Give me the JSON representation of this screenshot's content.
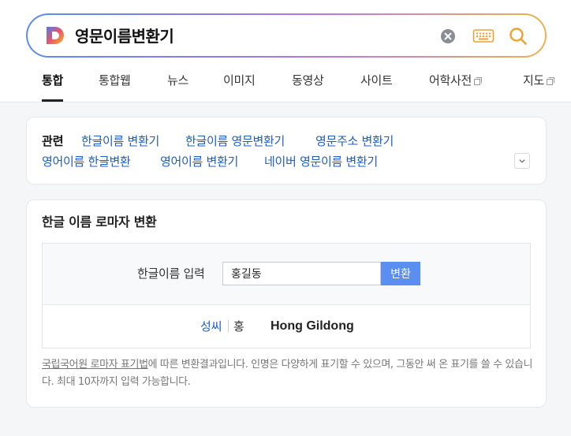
{
  "search": {
    "query": "영문이름변환기"
  },
  "tabs": [
    {
      "label": "통합"
    },
    {
      "label": "통합웹"
    },
    {
      "label": "뉴스"
    },
    {
      "label": "이미지"
    },
    {
      "label": "동영상"
    },
    {
      "label": "사이트"
    },
    {
      "label": "어학사전"
    },
    {
      "label": "지도"
    }
  ],
  "related": {
    "label": "관련",
    "links": [
      "한글이름 변환기",
      "한글이름 영문변환기",
      "영문주소 변환기",
      "영어이름 한글변환",
      "영어이름 변환기",
      "네이버 영문이름 변환기"
    ]
  },
  "converter": {
    "title": "한글 이름 로마자 변환",
    "input_label": "한글이름 입력",
    "input_value": "홍길동",
    "button_label": "변환",
    "sort_label": "성씨",
    "surname": "홍",
    "result": "Hong Gildong",
    "note_link": "국립국어원 로마자 표기법",
    "note_text": "에 따른 변환결과입니다. 인명은 다양하게 표기할 수 있으며, 그동안 써 온 표기를 쓸 수 있습니다. 최대 10자까지 입력 가능합니다."
  },
  "colors": {
    "link": "#1b5ec8",
    "button": "#5a8ef1",
    "logo": "#5b8def"
  }
}
